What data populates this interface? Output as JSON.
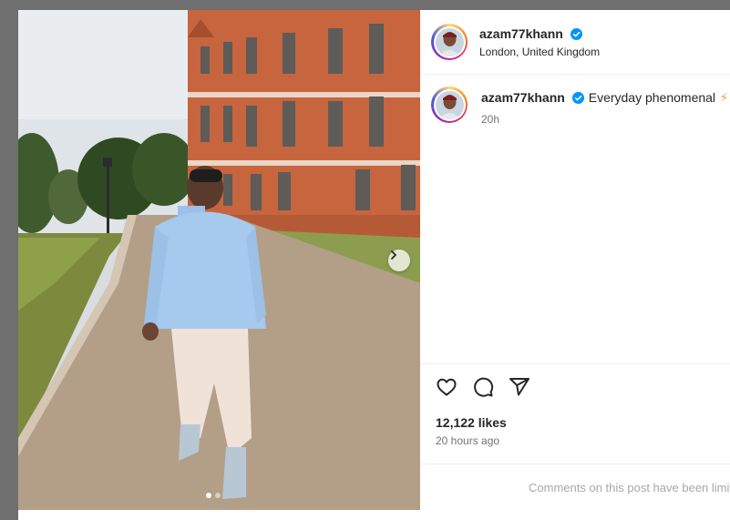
{
  "post": {
    "username": "azam77khann",
    "location": "London, United Kingdom",
    "caption": "Everyday phenomenal",
    "caption_emoji": "⚡",
    "caption_time": "20h",
    "likes": "12,122 likes",
    "post_time": "20 hours ago",
    "comments_notice": "Comments on this post have been limited.",
    "carousel": {
      "slides": 2,
      "active": 1
    }
  },
  "icons": {
    "verified": "verified-badge-icon",
    "like": "heart-icon",
    "comment": "comment-icon",
    "share": "share-icon",
    "next": "chevron-right-icon"
  },
  "colors": {
    "verified": "#0095f6",
    "text": "#262626",
    "muted": "#737373",
    "notice": "#a8a8a8"
  }
}
